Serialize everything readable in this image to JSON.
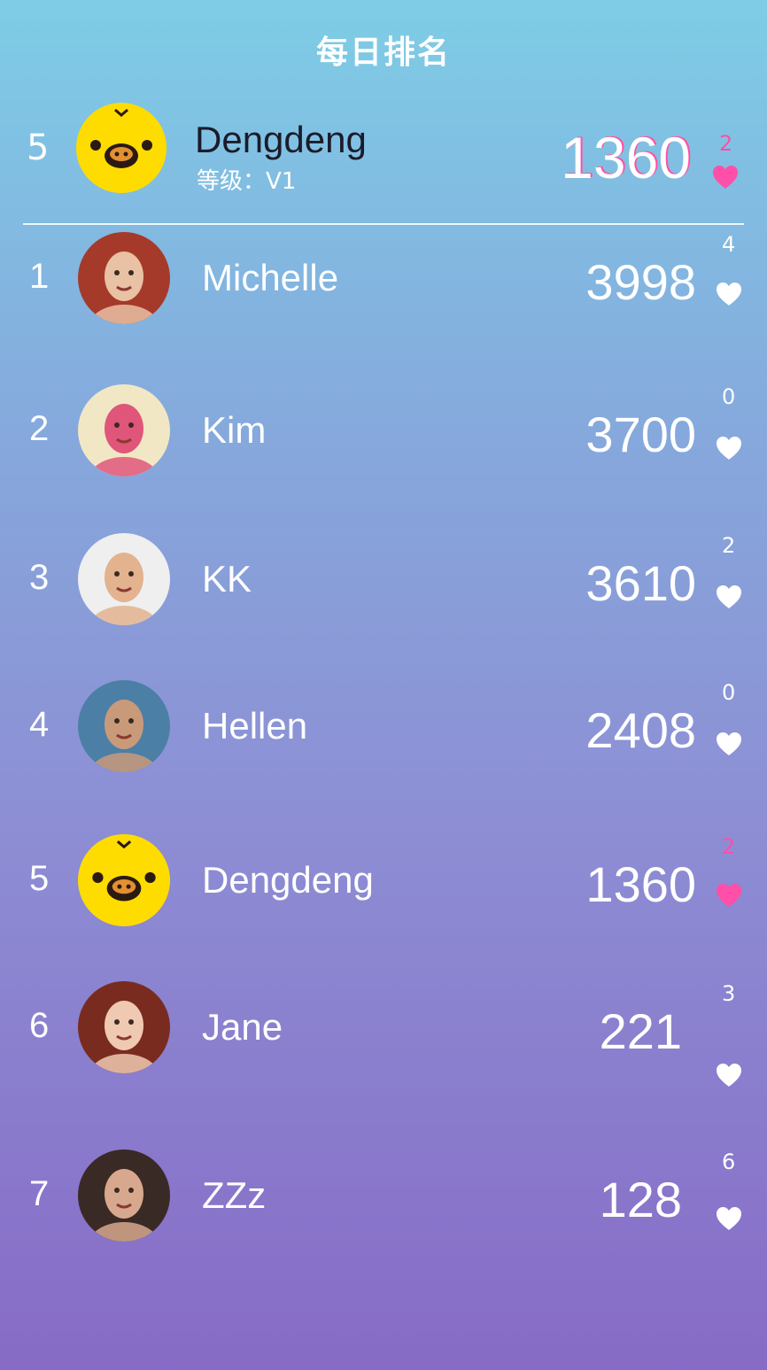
{
  "header": {
    "title": "每日排名"
  },
  "me": {
    "rank": "5",
    "name": "Dengdeng",
    "level": "等级：V1",
    "score": "1360",
    "likes": "2",
    "liked": true,
    "avatar": "chick-avatar"
  },
  "rows": [
    {
      "rank": "1",
      "name": "Michelle",
      "score": "3998",
      "likes": "4",
      "liked": false,
      "avatar": "photo-avatar",
      "colors": [
        "#a63a2a",
        "#e9c1a4"
      ]
    },
    {
      "rank": "2",
      "name": "Kim",
      "score": "3700",
      "likes": "0",
      "liked": false,
      "avatar": "photo-avatar",
      "colors": [
        "#f2e7c5",
        "#e0567a"
      ]
    },
    {
      "rank": "3",
      "name": "KK",
      "score": "3610",
      "likes": "2",
      "liked": false,
      "avatar": "photo-avatar",
      "colors": [
        "#efefef",
        "#e3b28f"
      ]
    },
    {
      "rank": "4",
      "name": "Hellen",
      "score": "2408",
      "likes": "0",
      "liked": false,
      "avatar": "photo-avatar",
      "colors": [
        "#4c7fa6",
        "#c99a79"
      ]
    },
    {
      "rank": "5",
      "name": "Dengdeng",
      "score": "1360",
      "likes": "2",
      "liked": true,
      "avatar": "chick-avatar",
      "colors": [
        "#ffdc00",
        "#2b1a12"
      ]
    },
    {
      "rank": "6",
      "name": "Jane",
      "score": "221",
      "likes": "3",
      "liked": false,
      "avatar": "photo-avatar",
      "colors": [
        "#7a2b20",
        "#f0c9b2"
      ]
    },
    {
      "rank": "7",
      "name": "ZZz",
      "score": "128",
      "likes": "6",
      "liked": false,
      "avatar": "photo-avatar",
      "colors": [
        "#3a2a25",
        "#d8a88e"
      ]
    }
  ],
  "colors": {
    "accent_pink": "#ff4fa8",
    "gradient_top": "#7ecde6",
    "gradient_bottom": "#876bc6"
  }
}
